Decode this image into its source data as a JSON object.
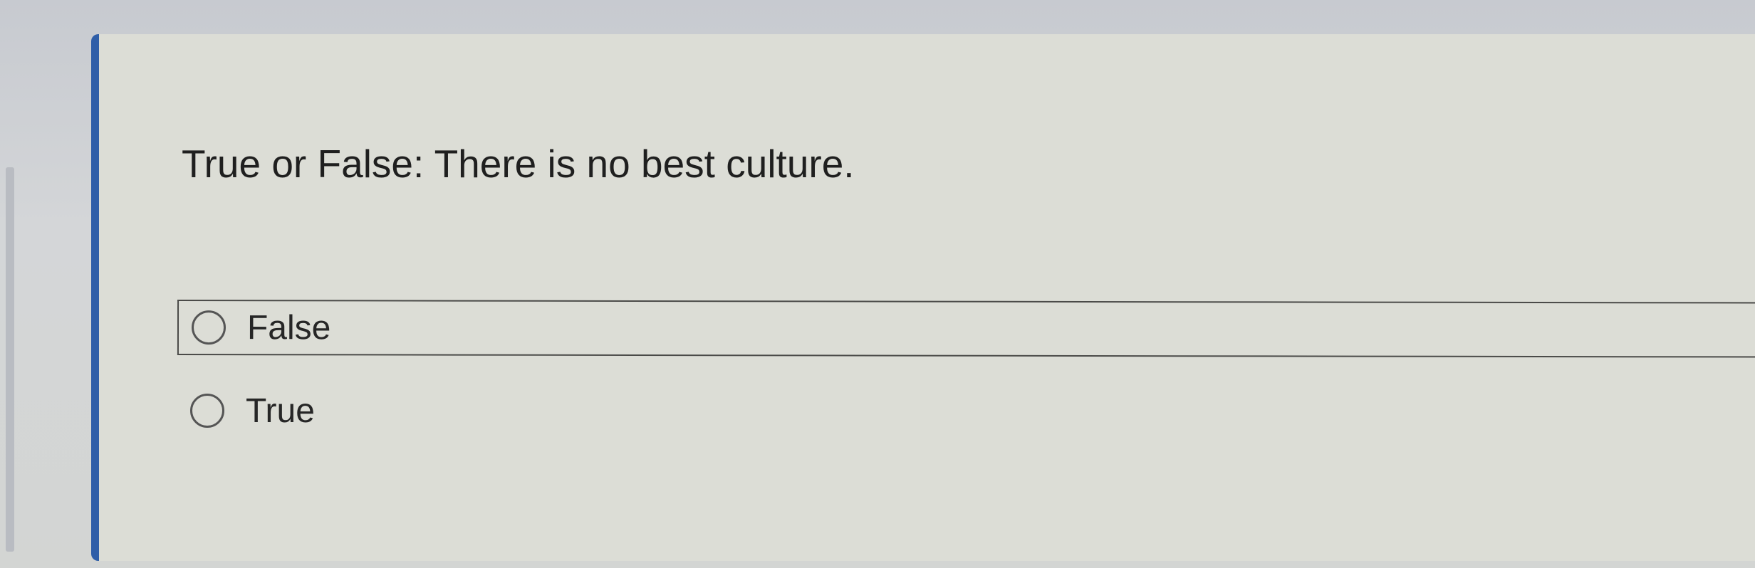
{
  "question": {
    "text": "True or False: There is no best culture."
  },
  "options": [
    {
      "label": "False",
      "selected": false
    },
    {
      "label": "True",
      "selected": false
    }
  ],
  "colors": {
    "accent": "#2f5ea8",
    "card_background": "#dcddd6",
    "text": "#1f1f1f"
  }
}
